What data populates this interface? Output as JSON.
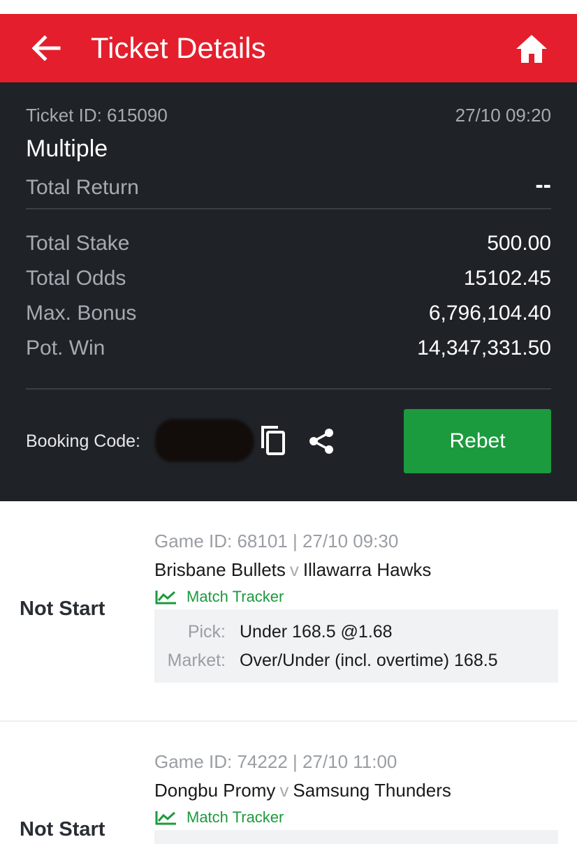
{
  "header": {
    "title": "Ticket Details",
    "back_icon": "arrow-left-icon",
    "home_icon": "home-icon",
    "color": "#e41e2c"
  },
  "summary": {
    "ticket_id_label": "Ticket ID: 615090",
    "datetime": "27/10 09:20",
    "bet_type": "Multiple",
    "total_return_label": "Total Return",
    "total_return_value": "--",
    "rows": [
      {
        "label": "Total Stake",
        "value": "500.00"
      },
      {
        "label": "Total Odds",
        "value": "15102.45"
      },
      {
        "label": "Max. Bonus",
        "value": "6,796,104.40"
      },
      {
        "label": "Pot. Win",
        "value": "14,347,331.50"
      }
    ],
    "booking_code_label": "Booking Code:",
    "rebet_label": "Rebet",
    "rebet_color": "#1c9a3e"
  },
  "games": [
    {
      "status": "Not Start",
      "meta": "Game ID: 68101 | 27/10 09:30",
      "home": "Brisbane Bullets",
      "vs": "v",
      "away": "Illawarra Hawks",
      "tracker": "Match Tracker",
      "pick_label": "Pick:",
      "pick_value": "Under 168.5 @1.68",
      "market_label": "Market:",
      "market_value": "Over/Under (incl. overtime) 168.5"
    },
    {
      "status": "Not Start",
      "meta": "Game ID: 74222 | 27/10 11:00",
      "home": "Dongbu Promy",
      "vs": "v",
      "away": "Samsung Thunders",
      "tracker": "Match Tracker"
    }
  ]
}
